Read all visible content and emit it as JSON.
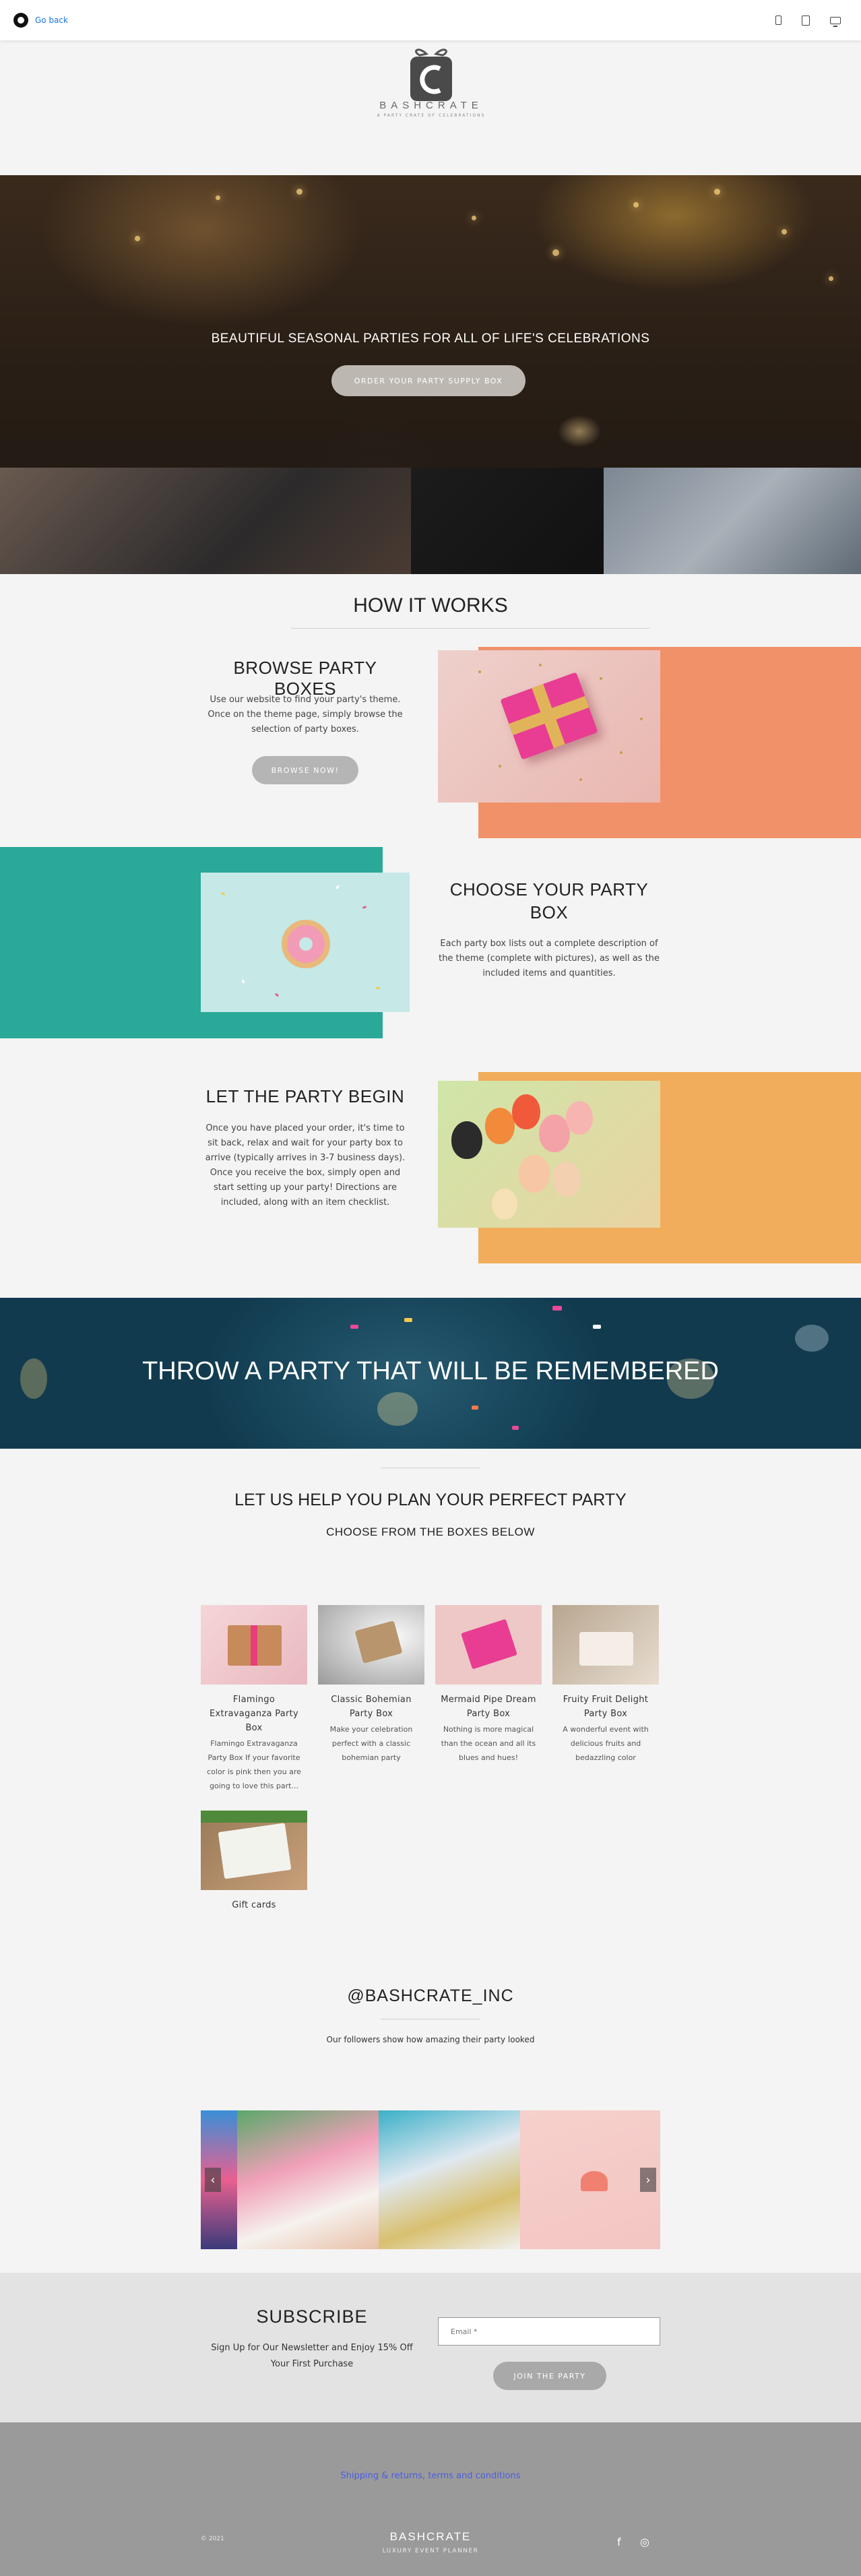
{
  "editor_bar": {
    "go_back_label": "Go back",
    "device_icons": [
      "mobile-icon",
      "tablet-icon",
      "desktop-icon"
    ]
  },
  "logo": {
    "brand": "BASHCRATE",
    "tagline": "A PARTY CRATE OF CELEBRATIONS",
    "letter": "C"
  },
  "hero": {
    "title": "BEAUTIFUL SEASONAL PARTIES FOR ALL OF LIFE'S CELEBRATIONS",
    "button_label": "ORDER YOUR PARTY SUPPLY BOX"
  },
  "how_it_works": {
    "title": "HOW IT WORKS",
    "steps": [
      {
        "heading": "BROWSE PARTY BOXES",
        "text": "Use our website to find your party's theme. Once on the theme page, simply browse the selection of party boxes.",
        "button_label": "BROWSE NOW!",
        "color": "#f0916a"
      },
      {
        "heading": "CHOOSE YOUR PARTY BOX",
        "text": "Each party box lists out a complete description of the theme (complete with pictures), as well as the included items and quantities.",
        "color": "#2aa898"
      },
      {
        "heading": "LET THE PARTY BEGIN",
        "text": "Once you have placed your order, it's time to sit back, relax and wait for your party box to arrive (typically arrives in 3-7 business days). Once you receive the box, simply open and start setting up your party! Directions are included, along with an item checklist.",
        "color": "#f1ad5b"
      }
    ]
  },
  "banner": {
    "title": "THROW A PARTY THAT WILL BE REMEMBERED"
  },
  "plan": {
    "title": "LET US HELP YOU PLAN YOUR PERFECT PARTY",
    "subtitle": "CHOOSE FROM THE BOXES BELOW",
    "products": [
      {
        "name": "Flamingo Extravaganza Party Box",
        "desc": "Flamingo Extravaganza Party Box If your favorite color is pink then you are going to love this part..."
      },
      {
        "name": "Classic Bohemian Party Box",
        "desc": "Make your celebration perfect with a classic bohemian party"
      },
      {
        "name": "Mermaid Pipe Dream Party Box",
        "desc": "Nothing is more magical than the ocean and all its blues and hues!"
      },
      {
        "name": "Fruity Fruit Delight Party Box",
        "desc": "A wonderful event with delicious fruits and bedazzling color"
      },
      {
        "name": "Gift cards",
        "desc": ""
      }
    ]
  },
  "instagram": {
    "title": "@BASHCRATE_INC",
    "subtitle": "Our followers show how amazing their party looked",
    "prev_glyph": "‹",
    "next_glyph": "›"
  },
  "subscribe": {
    "title": "SUBSCRIBE",
    "text": "Sign Up for Our Newsletter and Enjoy 15% Off Your First Purchase",
    "email_placeholder": "Email *",
    "button_label": "JOIN THE PARTY"
  },
  "footer": {
    "link": "Shipping & returns, terms and conditions",
    "copyright": "© 2021",
    "brand": "BASHCRATE",
    "tagline": "LUXURY EVENT PLANNER",
    "social_facebook": "f",
    "social_instagram": "◎"
  },
  "colors": {
    "accent_link": "#1a73e8",
    "footer_link": "#4a5ee0",
    "orange": "#f0916a",
    "teal": "#2aa898",
    "yellow": "#f1ad5b",
    "banner": "#164459"
  }
}
